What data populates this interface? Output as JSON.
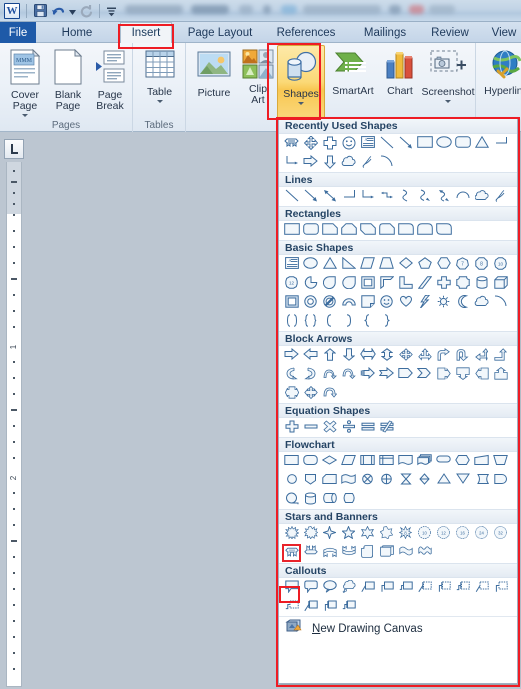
{
  "app": {
    "name": "Microsoft Word 2010",
    "logo_text": "W"
  },
  "quick_access_toolbar": {
    "items": [
      {
        "name": "save-icon",
        "label": "Save"
      },
      {
        "name": "undo-icon",
        "label": "Undo"
      },
      {
        "name": "undo-dropdown-icon",
        "label": "Undo options"
      },
      {
        "name": "redo-icon",
        "label": "Redo"
      },
      {
        "name": "customize-qat-icon",
        "label": "Customize Quick Access Toolbar"
      }
    ]
  },
  "tabs": [
    {
      "label": "File",
      "state": "file"
    },
    {
      "label": "Home",
      "state": "normal"
    },
    {
      "label": "Insert",
      "state": "active"
    },
    {
      "label": "Page Layout",
      "state": "normal"
    },
    {
      "label": "References",
      "state": "normal"
    },
    {
      "label": "Mailings",
      "state": "normal"
    },
    {
      "label": "Review",
      "state": "normal"
    },
    {
      "label": "View",
      "state": "normal"
    }
  ],
  "ribbon": {
    "groups": [
      {
        "name": "Pages",
        "label": "Pages",
        "buttons": [
          {
            "label": "Cover\nPage",
            "icon": "cover-page-icon",
            "has_dropdown": true
          },
          {
            "label": "Blank\nPage",
            "icon": "blank-page-icon",
            "has_dropdown": false
          },
          {
            "label": "Page\nBreak",
            "icon": "page-break-icon",
            "has_dropdown": false
          }
        ]
      },
      {
        "name": "Tables",
        "label": "Tables",
        "buttons": [
          {
            "label": "Table",
            "icon": "table-icon",
            "has_dropdown": true
          }
        ]
      },
      {
        "name": "Illustrations",
        "label": "",
        "buttons": [
          {
            "label": "Picture",
            "icon": "picture-icon",
            "has_dropdown": false
          },
          {
            "label": "Clip\nArt",
            "icon": "clip-art-icon",
            "has_dropdown": false
          },
          {
            "label": "Shapes",
            "icon": "shapes-icon",
            "has_dropdown": true,
            "highlighted": true
          },
          {
            "label": "SmartArt",
            "icon": "smartart-icon",
            "has_dropdown": false
          },
          {
            "label": "Chart",
            "icon": "chart-icon",
            "has_dropdown": false
          },
          {
            "label": "Screenshot",
            "icon": "screenshot-icon",
            "has_dropdown": true
          }
        ]
      },
      {
        "name": "Links",
        "label": "",
        "buttons": [
          {
            "label": "Hyperlink",
            "icon": "hyperlink-icon",
            "has_dropdown": false
          }
        ]
      }
    ]
  },
  "document": {
    "tab_stop_selector": "left-tab-stop",
    "ruler_numbers": [
      "1",
      "2"
    ]
  },
  "shapes_gallery": {
    "sections": [
      {
        "title": "Recently Used Shapes",
        "rows": [
          [
            "ribbon-tilted-up",
            "cross-arrows",
            "plus-cross",
            "smiley-face",
            "text-box",
            "line",
            "line-arrow",
            "rectangle",
            "oval",
            "rounded-rectangle",
            "isosceles-triangle",
            "elbow-connector"
          ],
          [
            "elbow-arrow-connector",
            "right-arrow",
            "down-arrow",
            "cloud",
            "scribble",
            "arc"
          ]
        ]
      },
      {
        "title": "Lines",
        "rows": [
          [
            "line",
            "line-arrow",
            "line-double-arrow",
            "elbow-connector",
            "elbow-arrow-connector",
            "elbow-double-arrow-connector",
            "curved-connector",
            "curved-arrow-connector",
            "curved-double-arrow-connector",
            "curve",
            "freeform",
            "scribble"
          ]
        ]
      },
      {
        "title": "Rectangles",
        "rows": [
          [
            "rectangle",
            "rounded-rectangle",
            "snip-single-corner-rectangle",
            "snip-same-side-corner-rectangle",
            "snip-diagonal-corner-rectangle",
            "snip-and-round-single-corner-rectangle",
            "round-single-corner-rectangle",
            "round-same-side-corner-rectangle",
            "round-diagonal-corner-rectangle"
          ]
        ]
      },
      {
        "title": "Basic Shapes",
        "rows": [
          [
            "text-box",
            "oval",
            "isosceles-triangle",
            "right-triangle",
            "parallelogram",
            "trapezoid",
            "diamond",
            "pentagon",
            "hexagon",
            "heptagon",
            "octagon",
            "decagon"
          ],
          [
            "dodecagon",
            "pie",
            "teardrop",
            "frame",
            "half-frame",
            "l-shape",
            "diagonal-stripe",
            "cross",
            "plaque",
            "can",
            "cube"
          ],
          [
            "bevel",
            "donut",
            "no-symbol",
            "block-arc",
            "folded-corner",
            "smiley-face",
            "heart",
            "lightning-bolt",
            "sun",
            "moon",
            "cloud",
            "arc"
          ],
          [
            "left-bracket",
            "right-bracket",
            "left-brace",
            "right-brace",
            "left-bracket-2",
            "right-bracket-2",
            "left-brace-2",
            "right-brace-2"
          ]
        ]
      },
      {
        "title": "Block Arrows",
        "rows": [
          [
            "right-arrow",
            "left-arrow",
            "up-arrow",
            "down-arrow",
            "left-right-arrow",
            "up-down-arrow",
            "quad-arrow",
            "left-right-up-arrow",
            "bent-arrow",
            "u-turn-arrow",
            "left-up-arrow",
            "bent-up-arrow"
          ],
          [
            "curved-right-arrow",
            "curved-left-arrow",
            "curved-up-arrow",
            "curved-down-arrow",
            "striped-right-arrow",
            "notched-right-arrow",
            "pentagon-arrow",
            "chevron",
            "right-arrow-callout",
            "down-arrow-callout",
            "left-arrow-callout",
            "up-arrow-callout"
          ],
          [
            "left-right-arrow-callout",
            "quad-arrow-callout",
            "circular-arrow"
          ]
        ]
      },
      {
        "title": "Equation Shapes",
        "rows": [
          [
            "plus-sign",
            "minus-sign",
            "multiply-sign",
            "division-sign",
            "equal-sign",
            "not-equal-sign"
          ]
        ]
      },
      {
        "title": "Flowchart",
        "rows": [
          [
            "flowchart-process",
            "flowchart-alternate-process",
            "flowchart-decision",
            "flowchart-data",
            "flowchart-predefined-process",
            "flowchart-internal-storage",
            "flowchart-document",
            "flowchart-multidocument",
            "flowchart-terminator",
            "flowchart-preparation",
            "flowchart-manual-input",
            "flowchart-manual-operation"
          ],
          [
            "flowchart-connector",
            "flowchart-off-page-connector",
            "flowchart-card",
            "flowchart-punched-tape",
            "flowchart-summing-junction",
            "flowchart-or",
            "flowchart-collate",
            "flowchart-sort",
            "flowchart-extract",
            "flowchart-merge",
            "flowchart-stored-data",
            "flowchart-delay"
          ],
          [
            "flowchart-sequential-access-storage",
            "flowchart-magnetic-disk",
            "flowchart-direct-access-storage",
            "flowchart-display"
          ]
        ]
      },
      {
        "title": "Stars and Banners",
        "rows": [
          [
            "explosion-1",
            "explosion-2",
            "star-4-point",
            "star-5-point",
            "star-6-point",
            "star-7-point",
            "star-8-point",
            "star-10-point",
            "star-12-point",
            "star-16-point",
            "star-24-point",
            "star-32-point"
          ],
          [
            "ribbon-tilted-up",
            "ribbon-tilted-down",
            "curved-up-ribbon",
            "curved-down-ribbon",
            "vertical-scroll",
            "horizontal-scroll",
            "wave",
            "double-wave"
          ]
        ],
        "selected": {
          "row": 1,
          "index": 0,
          "name": "ribbon-tilted-up"
        }
      },
      {
        "title": "Callouts",
        "rows": [
          [
            "rectangular-callout",
            "rounded-rectangular-callout",
            "oval-callout",
            "cloud-callout",
            "line-callout-1",
            "line-callout-2",
            "line-callout-3",
            "line-callout-1-accent-bar",
            "line-callout-2-accent-bar",
            "line-callout-3-accent-bar",
            "line-callout-1-no-border",
            "line-callout-2-no-border"
          ],
          [
            "line-callout-3-no-border",
            "line-callout-1-border-and-accent-bar",
            "line-callout-2-border-and-accent-bar",
            "line-callout-3-border-and-accent-bar"
          ]
        ]
      }
    ],
    "footer": {
      "icon": "new-drawing-canvas-icon",
      "label": "New Drawing Canvas",
      "accelerator": "N"
    }
  },
  "annotations": {
    "color": "#ee1c24",
    "boxes": [
      {
        "name": "insert-tab-highlight",
        "target": "Insert tab"
      },
      {
        "name": "shapes-button-highlight",
        "target": "Shapes button"
      },
      {
        "name": "shapes-gallery-highlight",
        "target": "Shapes gallery panel"
      },
      {
        "name": "ribbon-shape-highlight",
        "target": "Ribbon: Tilted Up shape"
      }
    ]
  }
}
